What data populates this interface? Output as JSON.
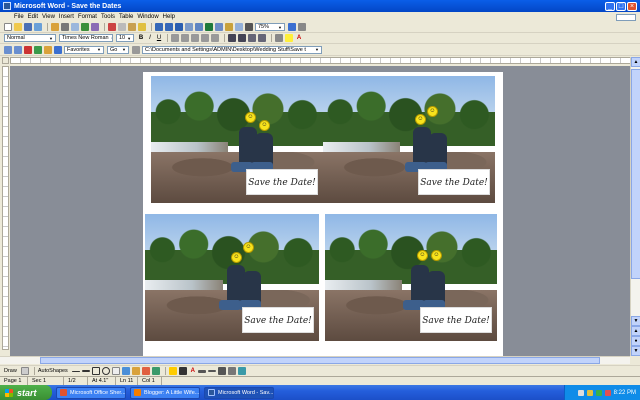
{
  "window": {
    "title": "Microsoft Word - Save the Dates"
  },
  "menu": [
    "File",
    "Edit",
    "View",
    "Insert",
    "Format",
    "Tools",
    "Table",
    "Window",
    "Help"
  ],
  "standard_toolbar": {
    "zoom": "75%"
  },
  "formatting_toolbar": {
    "style": "Normal",
    "font": "Times New Roman",
    "size": "10"
  },
  "web_toolbar": {
    "favorites": "Favorites",
    "go": "Go",
    "address": "C:\\Documents and Settings\\ADMIN\\Desktop\\Wedding Stuff\\Save t"
  },
  "document": {
    "cards": [
      {
        "label": "Save the Date!"
      },
      {
        "label": "Save the Date!"
      },
      {
        "label": "Save the Date!"
      },
      {
        "label": "Save the Date!"
      }
    ]
  },
  "drawing_toolbar": {
    "draw": "Draw",
    "autoshapes": "AutoShapes"
  },
  "status": {
    "page": "Page 1",
    "sec": "Sec 1",
    "pages": "1/2",
    "at": "At 4.1\"",
    "ln": "Ln 11",
    "col": "Col 1"
  },
  "taskbar": {
    "start": "start",
    "tasks": [
      {
        "label": "Microsoft Office Sher..."
      },
      {
        "label": "Blogger: A Little Wife..."
      },
      {
        "label": "Microsoft Word - Sav..."
      }
    ],
    "clock": "8:22 PM"
  },
  "colors": {
    "title_blue": "#0346c6",
    "taskbar_blue": "#245edb",
    "start_green": "#3a8f33",
    "doc_bg": "#888d97"
  }
}
